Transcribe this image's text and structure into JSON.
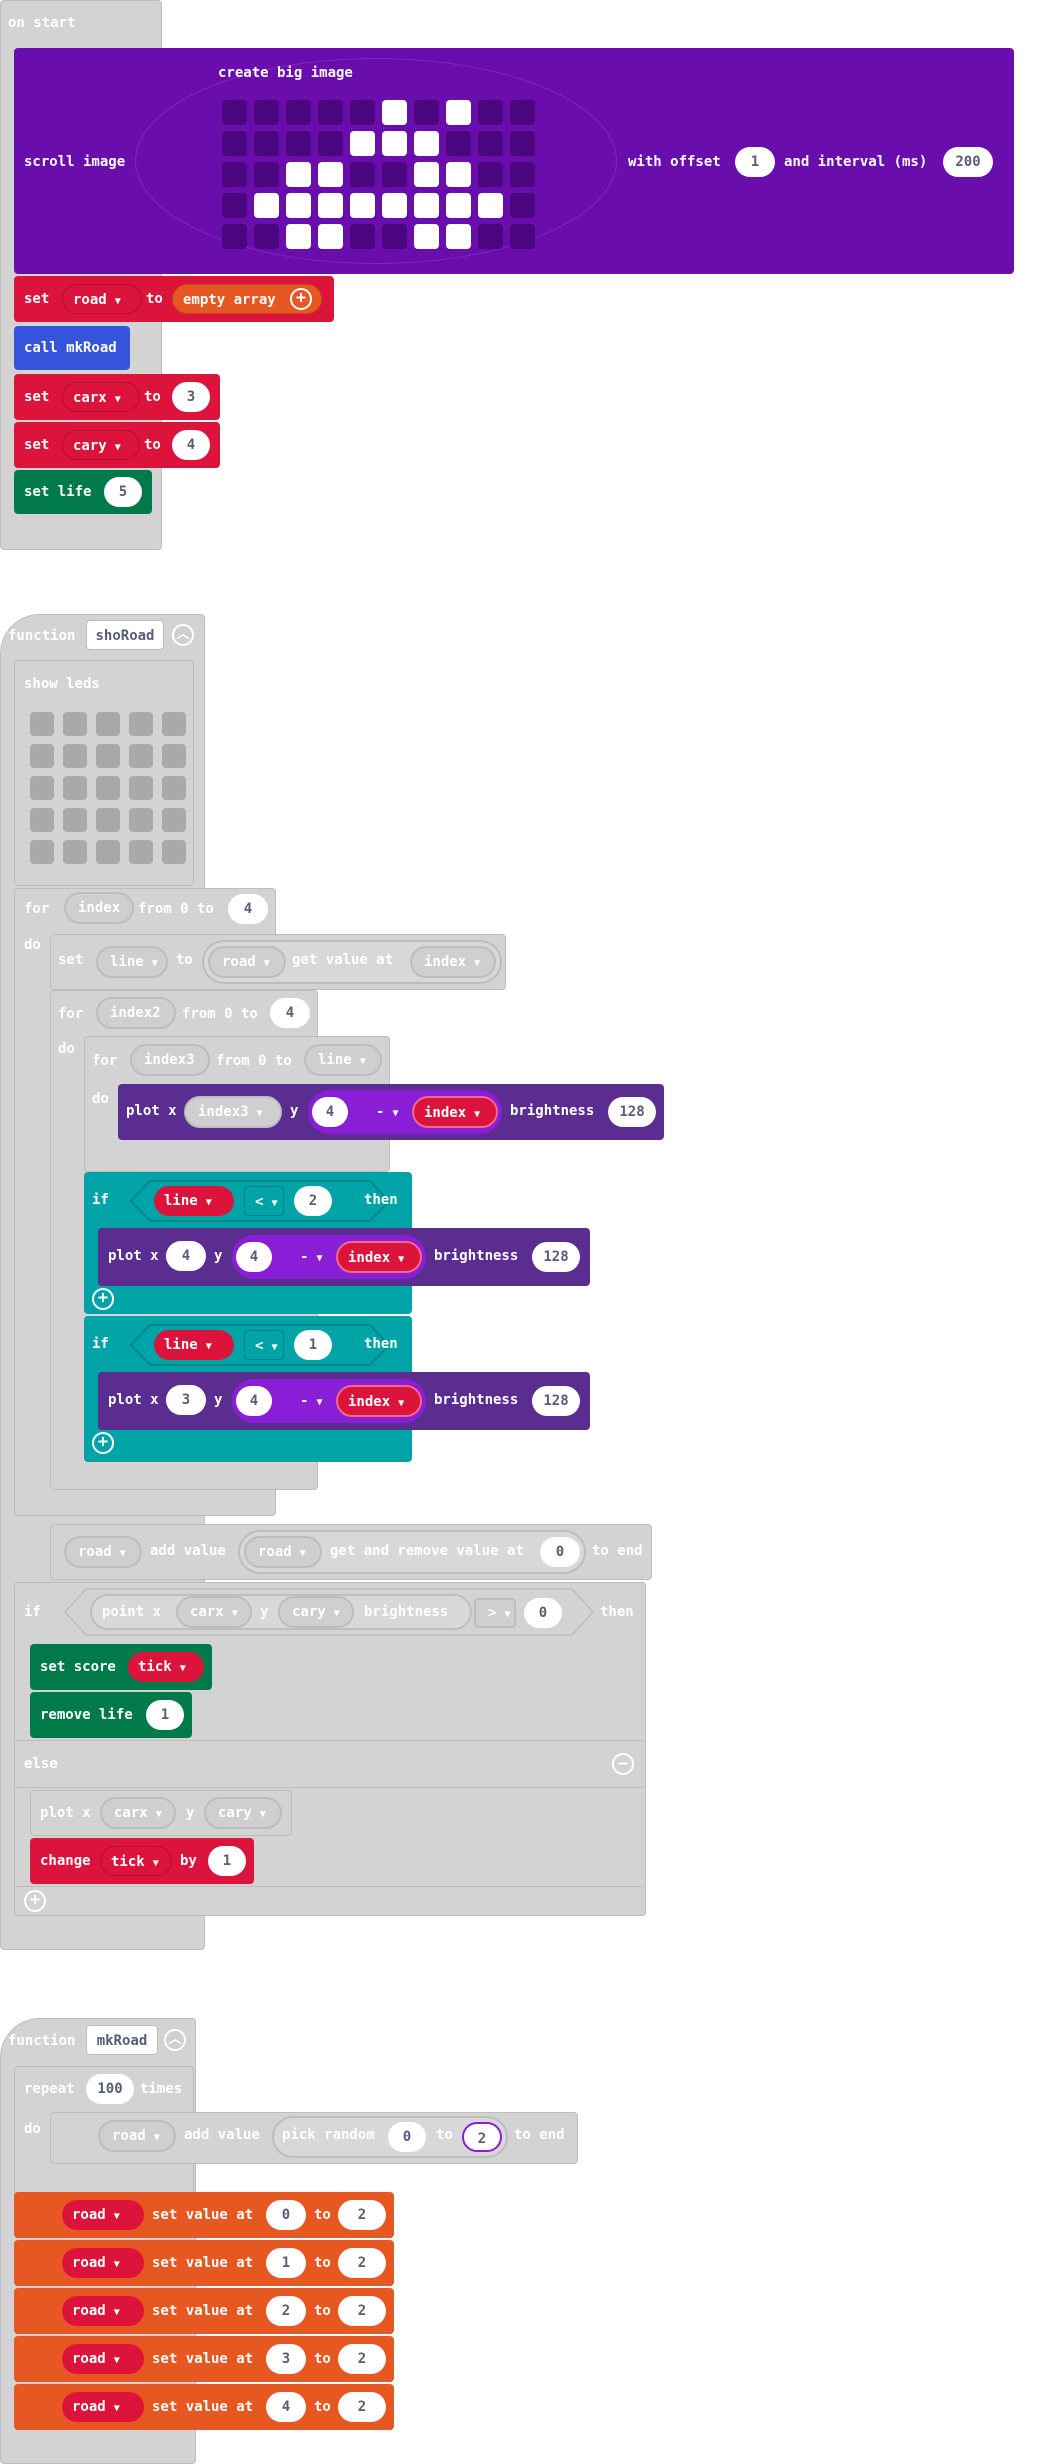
{
  "colors": {
    "purple_image": "#6a0dad",
    "variables_red": "#dc143c",
    "arrays_orange": "#e65722",
    "functions_blue": "#3455db",
    "game_green": "#007a4b",
    "led_purple": "#5c2d91",
    "logic_teal": "#00a4a6",
    "disabled_gray": "#d3d3d3"
  },
  "on_start": {
    "hat_label": "on start",
    "scroll_image": {
      "label": "scroll image",
      "create_label": "create big image",
      "with_offset_label": "with offset",
      "offset": "1",
      "interval_label": "and interval (ms)",
      "interval": "200",
      "grid_rows": [
        "0000010100",
        "0000111000",
        "0011001100",
        "0111111110",
        "0011001100"
      ]
    },
    "set_road": {
      "set": "set",
      "var": "road",
      "to": "to",
      "value": "empty array"
    },
    "call_mkroad": {
      "label": "call mkRoad"
    },
    "set_carx": {
      "set": "set",
      "var": "carx",
      "to": "to",
      "value": "3"
    },
    "set_cary": {
      "set": "set",
      "var": "cary",
      "to": "to",
      "value": "4"
    },
    "set_life": {
      "label": "set life",
      "value": "5"
    }
  },
  "sho_road": {
    "function_label": "function",
    "name": "shoRoad",
    "show_leds_label": "show leds",
    "for1": {
      "for": "for",
      "var": "index",
      "from": "from 0 to",
      "to": "4",
      "do": "do"
    },
    "set_line": {
      "set": "set",
      "var": "line",
      "to": "to",
      "src": "road",
      "get": "get value at",
      "idx": "index"
    },
    "for2": {
      "for": "for",
      "var": "index2",
      "from": "from 0 to",
      "to": "4",
      "do": "do"
    },
    "for3": {
      "for": "for",
      "var": "index3",
      "from": "from 0 to",
      "to": "line",
      "do": "do"
    },
    "plot1": {
      "plot": "plot x",
      "x": "index3",
      "y": "y",
      "a": "4",
      "op": "-",
      "b": "index",
      "br": "brightness",
      "val": "128"
    },
    "if1": {
      "if": "if",
      "var": "line",
      "op": "<",
      "val": "2",
      "then": "then",
      "plot": "plot x",
      "x": "4",
      "y": "y",
      "a": "4",
      "op2": "-",
      "b": "index",
      "br": "brightness",
      "bval": "128"
    },
    "if2": {
      "if": "if",
      "var": "line",
      "op": "<",
      "val": "1",
      "then": "then",
      "plot": "plot x",
      "x": "3",
      "y": "y",
      "a": "4",
      "op2": "-",
      "b": "index",
      "br": "brightness",
      "bval": "128"
    },
    "road_add": {
      "var": "road",
      "add": "add value",
      "src": "road",
      "get": "get and remove value at",
      "idx": "0",
      "end": "to end"
    },
    "if3": {
      "if": "if",
      "point": "point x",
      "x": "carx",
      "y": "y",
      "yv": "cary",
      "br": "brightness",
      "op": ">",
      "val": "0",
      "then": "then"
    },
    "set_score": {
      "label": "set score",
      "var": "tick"
    },
    "remove_life": {
      "label": "remove life",
      "val": "1"
    },
    "else_label": "else",
    "plot_car": {
      "plot": "plot x",
      "x": "carx",
      "y": "y",
      "yv": "cary"
    },
    "change_tick": {
      "change": "change",
      "var": "tick",
      "by": "by",
      "val": "1"
    }
  },
  "mk_road": {
    "function_label": "function",
    "name": "mkRoad",
    "repeat": {
      "repeat": "repeat",
      "times_val": "100",
      "times": "times",
      "do": "do"
    },
    "add_random": {
      "var": "road",
      "add": "add value",
      "pick": "pick random",
      "a": "0",
      "to": "to",
      "b": "2",
      "end": "to end"
    },
    "set_values": [
      {
        "var": "road",
        "label": "set value at",
        "idx": "0",
        "to": "to",
        "val": "2"
      },
      {
        "var": "road",
        "label": "set value at",
        "idx": "1",
        "to": "to",
        "val": "2"
      },
      {
        "var": "road",
        "label": "set value at",
        "idx": "2",
        "to": "to",
        "val": "2"
      },
      {
        "var": "road",
        "label": "set value at",
        "idx": "3",
        "to": "to",
        "val": "2"
      },
      {
        "var": "road",
        "label": "set value at",
        "idx": "4",
        "to": "to",
        "val": "2"
      }
    ]
  }
}
